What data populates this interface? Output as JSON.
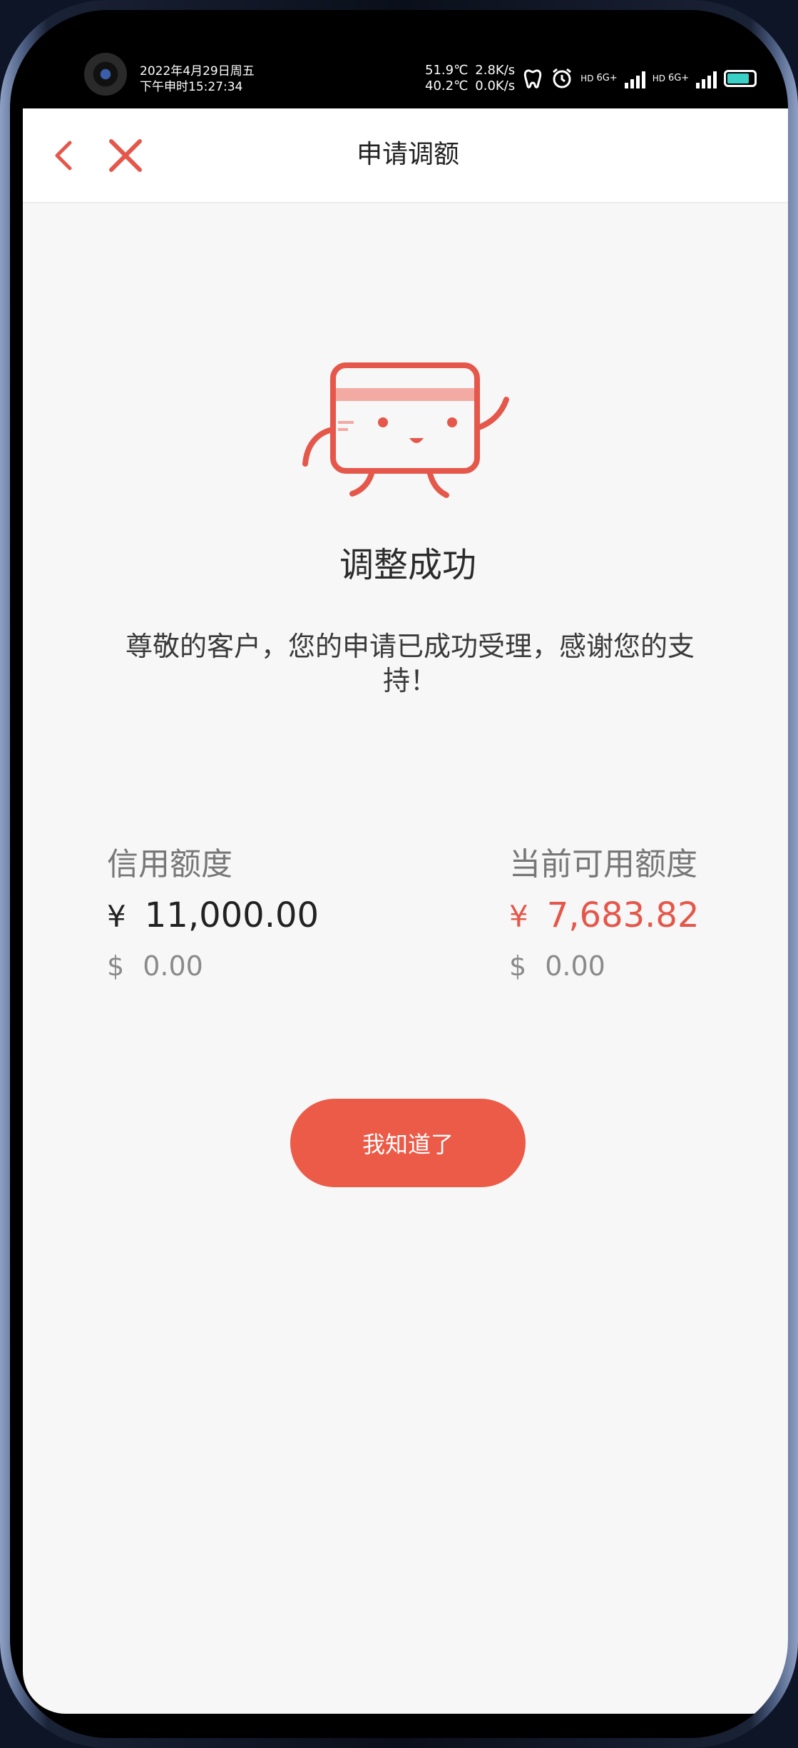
{
  "statusbar": {
    "date": "2022年4月29日周五",
    "lunar_time": "下午申时15:27:34",
    "temp1": "51.9℃",
    "temp2": "40.2℃",
    "speed1": "2.8K/s",
    "speed2": "0.0K/s",
    "net1": "6G+",
    "net2": "6G+",
    "hd": "HD"
  },
  "header": {
    "title": "申请调额"
  },
  "result": {
    "title": "调整成功",
    "message": "尊敬的客户，您的申请已成功受理，感谢您的支持！"
  },
  "credit": {
    "label": "信用额度",
    "cny_symbol": "¥",
    "cny_value": "11,000.00",
    "usd_symbol": "$",
    "usd_value": "0.00"
  },
  "available": {
    "label": "当前可用额度",
    "cny_symbol": "¥",
    "cny_value": "7,683.82",
    "usd_symbol": "$",
    "usd_value": "0.00"
  },
  "actions": {
    "ok_label": "我知道了"
  },
  "colors": {
    "accent": "#ec5a48",
    "available_text": "#e5574a",
    "battery": "#3ad0c6"
  }
}
